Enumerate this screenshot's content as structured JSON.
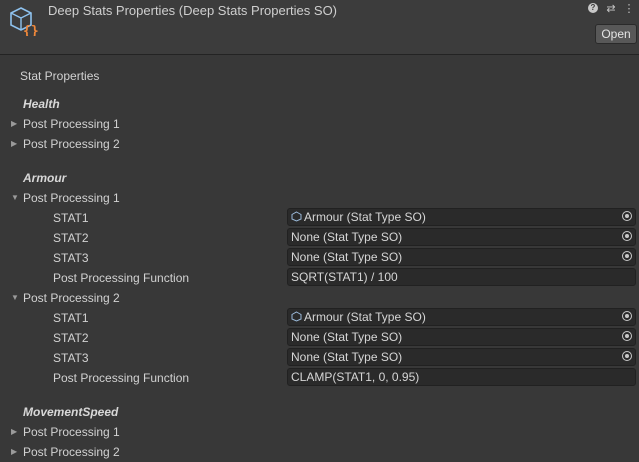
{
  "header": {
    "title": "Deep Stats Properties (Deep Stats Properties SO)",
    "open_label": "Open",
    "icons": [
      "help-icon",
      "settings-icon",
      "more-icon"
    ]
  },
  "section_title": "Stat Properties",
  "groups": {
    "health": {
      "name": "Health",
      "pp1": "Post Processing 1",
      "pp2": "Post Processing 2"
    },
    "armour": {
      "name": "Armour",
      "pp1": {
        "label": "Post Processing 1",
        "stat1_label": "STAT1",
        "stat1_value": "Armour (Stat Type SO)",
        "stat2_label": "STAT2",
        "stat2_value": "None (Stat Type SO)",
        "stat3_label": "STAT3",
        "stat3_value": "None (Stat Type SO)",
        "func_label": "Post Processing Function",
        "func_value": "SQRT(STAT1) / 100"
      },
      "pp2": {
        "label": "Post Processing 2",
        "stat1_label": "STAT1",
        "stat1_value": "Armour (Stat Type SO)",
        "stat2_label": "STAT2",
        "stat2_value": "None (Stat Type SO)",
        "stat3_label": "STAT3",
        "stat3_value": "None (Stat Type SO)",
        "func_label": "Post Processing Function",
        "func_value": "CLAMP(STAT1, 0, 0.95)"
      }
    },
    "movement": {
      "name": "MovementSpeed",
      "pp1": "Post Processing 1",
      "pp2": "Post Processing 2"
    }
  },
  "colors": {
    "background": "#383838",
    "field": "#2a2a2a",
    "asset_icon": "#7fb8e8"
  }
}
